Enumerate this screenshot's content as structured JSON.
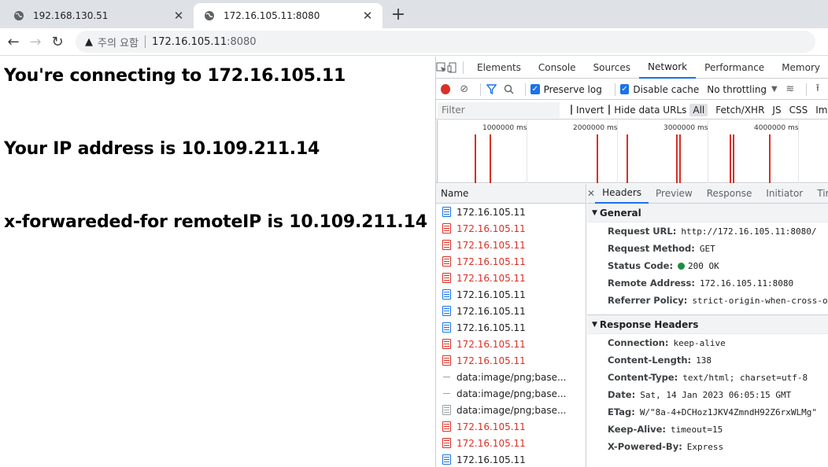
{
  "browser": {
    "tabs": [
      {
        "title": "192.168.130.51",
        "active": false
      },
      {
        "title": "172.16.105.11:8080",
        "active": true
      }
    ],
    "address": {
      "warning": "주의 요함",
      "host": "172.16.105.11",
      "port": ":8080"
    }
  },
  "page": {
    "lines": [
      "You're connecting to 172.16.105.11",
      "Your IP address is 10.109.211.14",
      "x-forwareded-for remoteIP is 10.109.211.14"
    ]
  },
  "devtools": {
    "tabs": [
      "Elements",
      "Console",
      "Sources",
      "Network",
      "Performance",
      "Memory"
    ],
    "selected_tab": "Network",
    "toolbar": {
      "preserve_log": "Preserve log",
      "disable_cache": "Disable cache",
      "throttling": "No throttling"
    },
    "filter": {
      "placeholder": "Filter",
      "invert": "Invert",
      "hide_data_urls": "Hide data URLs",
      "types": [
        "All",
        "Fetch/XHR",
        "JS",
        "CSS",
        "Im"
      ]
    },
    "overview": {
      "tick_labels": [
        "1000000 ms",
        "2000000 ms",
        "3000000 ms",
        "4000000 ms"
      ]
    },
    "requests": {
      "header": "Name",
      "rows": [
        {
          "name": "172.16.105.11",
          "status": "doc"
        },
        {
          "name": "172.16.105.11",
          "status": "err"
        },
        {
          "name": "172.16.105.11",
          "status": "err"
        },
        {
          "name": "172.16.105.11",
          "status": "err"
        },
        {
          "name": "172.16.105.11",
          "status": "err"
        },
        {
          "name": "172.16.105.11",
          "status": "doc"
        },
        {
          "name": "172.16.105.11",
          "status": "doc"
        },
        {
          "name": "172.16.105.11",
          "status": "doc"
        },
        {
          "name": "172.16.105.11",
          "status": "err"
        },
        {
          "name": "172.16.105.11",
          "status": "err"
        },
        {
          "name": "data:image/png;base...",
          "status": "dash"
        },
        {
          "name": "data:image/png;base...",
          "status": "dash"
        },
        {
          "name": "data:image/png;base...",
          "status": "img"
        },
        {
          "name": "172.16.105.11",
          "status": "err"
        },
        {
          "name": "172.16.105.11",
          "status": "err"
        },
        {
          "name": "172.16.105.11",
          "status": "doc"
        }
      ]
    },
    "detail": {
      "tabs": [
        "Headers",
        "Preview",
        "Response",
        "Initiator",
        "Tim"
      ],
      "selected_tab": "Headers",
      "general": {
        "title": "General",
        "request_url_k": "Request URL:",
        "request_url_v": "http://172.16.105.11:8080/",
        "method_k": "Request Method:",
        "method_v": "GET",
        "status_k": "Status Code:",
        "status_v": "200 OK",
        "remote_k": "Remote Address:",
        "remote_v": "172.16.105.11:8080",
        "referrer_k": "Referrer Policy:",
        "referrer_v": "strict-origin-when-cross-orig"
      },
      "response": {
        "title": "Response Headers",
        "headers": [
          {
            "k": "Connection:",
            "v": "keep-alive"
          },
          {
            "k": "Content-Length:",
            "v": "138"
          },
          {
            "k": "Content-Type:",
            "v": "text/html; charset=utf-8"
          },
          {
            "k": "Date:",
            "v": "Sat, 14 Jan 2023 06:05:15 GMT"
          },
          {
            "k": "ETag:",
            "v": "W/\"8a-4+DCHoz1JKV4ZmndH92Z6rxWLMg\""
          },
          {
            "k": "Keep-Alive:",
            "v": "timeout=15"
          },
          {
            "k": "X-Powered-By:",
            "v": "Express"
          }
        ]
      }
    }
  }
}
